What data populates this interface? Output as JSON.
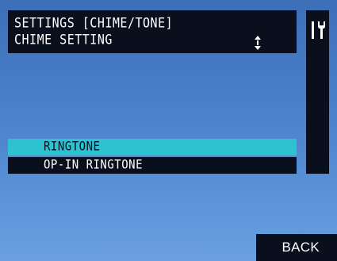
{
  "header": {
    "title": "SETTINGS [CHIME/TONE]",
    "subtitle": "CHIME SETTING",
    "scroll_icon": "up-down-arrows-icon"
  },
  "side_panel": {
    "icon": "tools-icon"
  },
  "menu": {
    "items": [
      {
        "label": "RINGTONE",
        "selected": true
      },
      {
        "label": "OP-IN RINGTONE",
        "selected": false
      }
    ]
  },
  "footer": {
    "back_label": "BACK"
  },
  "colors": {
    "background_top": "#3d6fb8",
    "background_bottom": "#6aa0e0",
    "panel": "#0a0f1e",
    "highlight": "#2cc2cf",
    "text": "#ffffff"
  }
}
